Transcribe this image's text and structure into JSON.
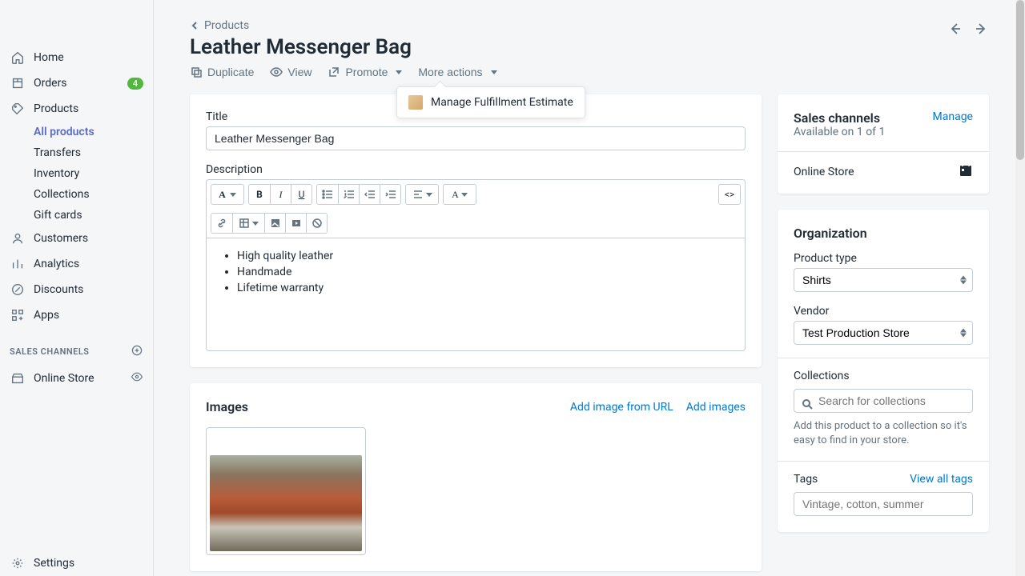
{
  "sidebar": {
    "home": "Home",
    "orders": "Orders",
    "orders_badge": "4",
    "products": "Products",
    "sub": {
      "all_products": "All products",
      "transfers": "Transfers",
      "inventory": "Inventory",
      "collections": "Collections",
      "gift_cards": "Gift cards"
    },
    "customers": "Customers",
    "analytics": "Analytics",
    "discounts": "Discounts",
    "apps": "Apps",
    "channels_header": "SALES CHANNELS",
    "online_store": "Online Store",
    "settings": "Settings"
  },
  "header": {
    "breadcrumb": "Products",
    "title": "Leather Messenger Bag"
  },
  "actions": {
    "duplicate": "Duplicate",
    "view": "View",
    "promote": "Promote",
    "more": "More actions"
  },
  "popover": {
    "label": "Manage Fulfillment Estimate"
  },
  "title_card": {
    "title_label": "Title",
    "title_value": "Leather Messenger Bag",
    "desc_label": "Description",
    "bullets": [
      "High quality leather",
      "Handmade",
      "Lifetime warranty"
    ]
  },
  "images_card": {
    "title": "Images",
    "add_url": "Add image from URL",
    "add_images": "Add images"
  },
  "channels": {
    "title": "Sales channels",
    "sub": "Available on 1 of 1",
    "manage": "Manage",
    "online_store": "Online Store"
  },
  "org": {
    "title": "Organization",
    "product_type_label": "Product type",
    "product_type_value": "Shirts",
    "vendor_label": "Vendor",
    "vendor_value": "Test Production Store",
    "collections_label": "Collections",
    "collections_placeholder": "Search for collections",
    "collections_help": "Add this product to a collection so it's easy to find in your store.",
    "tags_label": "Tags",
    "tags_link": "View all tags",
    "tags_placeholder": "Vintage, cotton, summer"
  }
}
